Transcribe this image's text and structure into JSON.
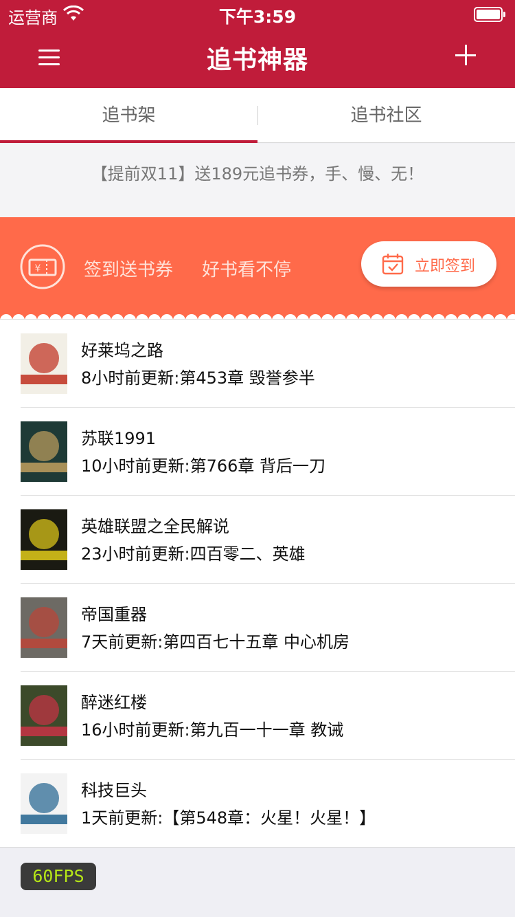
{
  "status_bar": {
    "carrier": "运营商",
    "time": "下午3:59"
  },
  "nav": {
    "title": "追书神器"
  },
  "tabs": [
    {
      "label": "追书架",
      "active": true
    },
    {
      "label": "追书社区",
      "active": false
    }
  ],
  "notice": {
    "text": "【提前双11】送189元追书券，手、慢、无！"
  },
  "signin": {
    "slogan_1": "签到送书券",
    "slogan_2": "好书看不停",
    "ticket_symbol": "¥",
    "button_label": "立即签到",
    "banner_color": "#ff6a4a"
  },
  "books": [
    {
      "title": "好莱坞之路",
      "update": "8小时前更新:第453章 毁誉参半",
      "cover_colors": [
        "#f2efe6",
        "#c23a2a"
      ]
    },
    {
      "title": "苏联1991",
      "update": "10小时前更新:第766章 背后一刀",
      "cover_colors": [
        "#1e3a36",
        "#b79a5c"
      ]
    },
    {
      "title": "英雄联盟之全民解说",
      "update": "23小时前更新:四百零二、英雄",
      "cover_colors": [
        "#1a1a12",
        "#d7c21a"
      ]
    },
    {
      "title": "帝国重器",
      "update": "7天前更新:第四百七十五章 中心机房",
      "cover_colors": [
        "#6d6a64",
        "#b8473a"
      ]
    },
    {
      "title": "醉迷红楼",
      "update": "16小时前更新:第九百一十一章 教诫",
      "cover_colors": [
        "#3c4a2a",
        "#c03444"
      ]
    },
    {
      "title": "科技巨头",
      "update": "1天前更新:【第548章：火星！火星！】",
      "cover_colors": [
        "#f3f3f3",
        "#2f6c95"
      ]
    }
  ],
  "fps_badge": "60FPS",
  "colors": {
    "brand": "#c01c3a",
    "accent": "#ff6a4a"
  }
}
